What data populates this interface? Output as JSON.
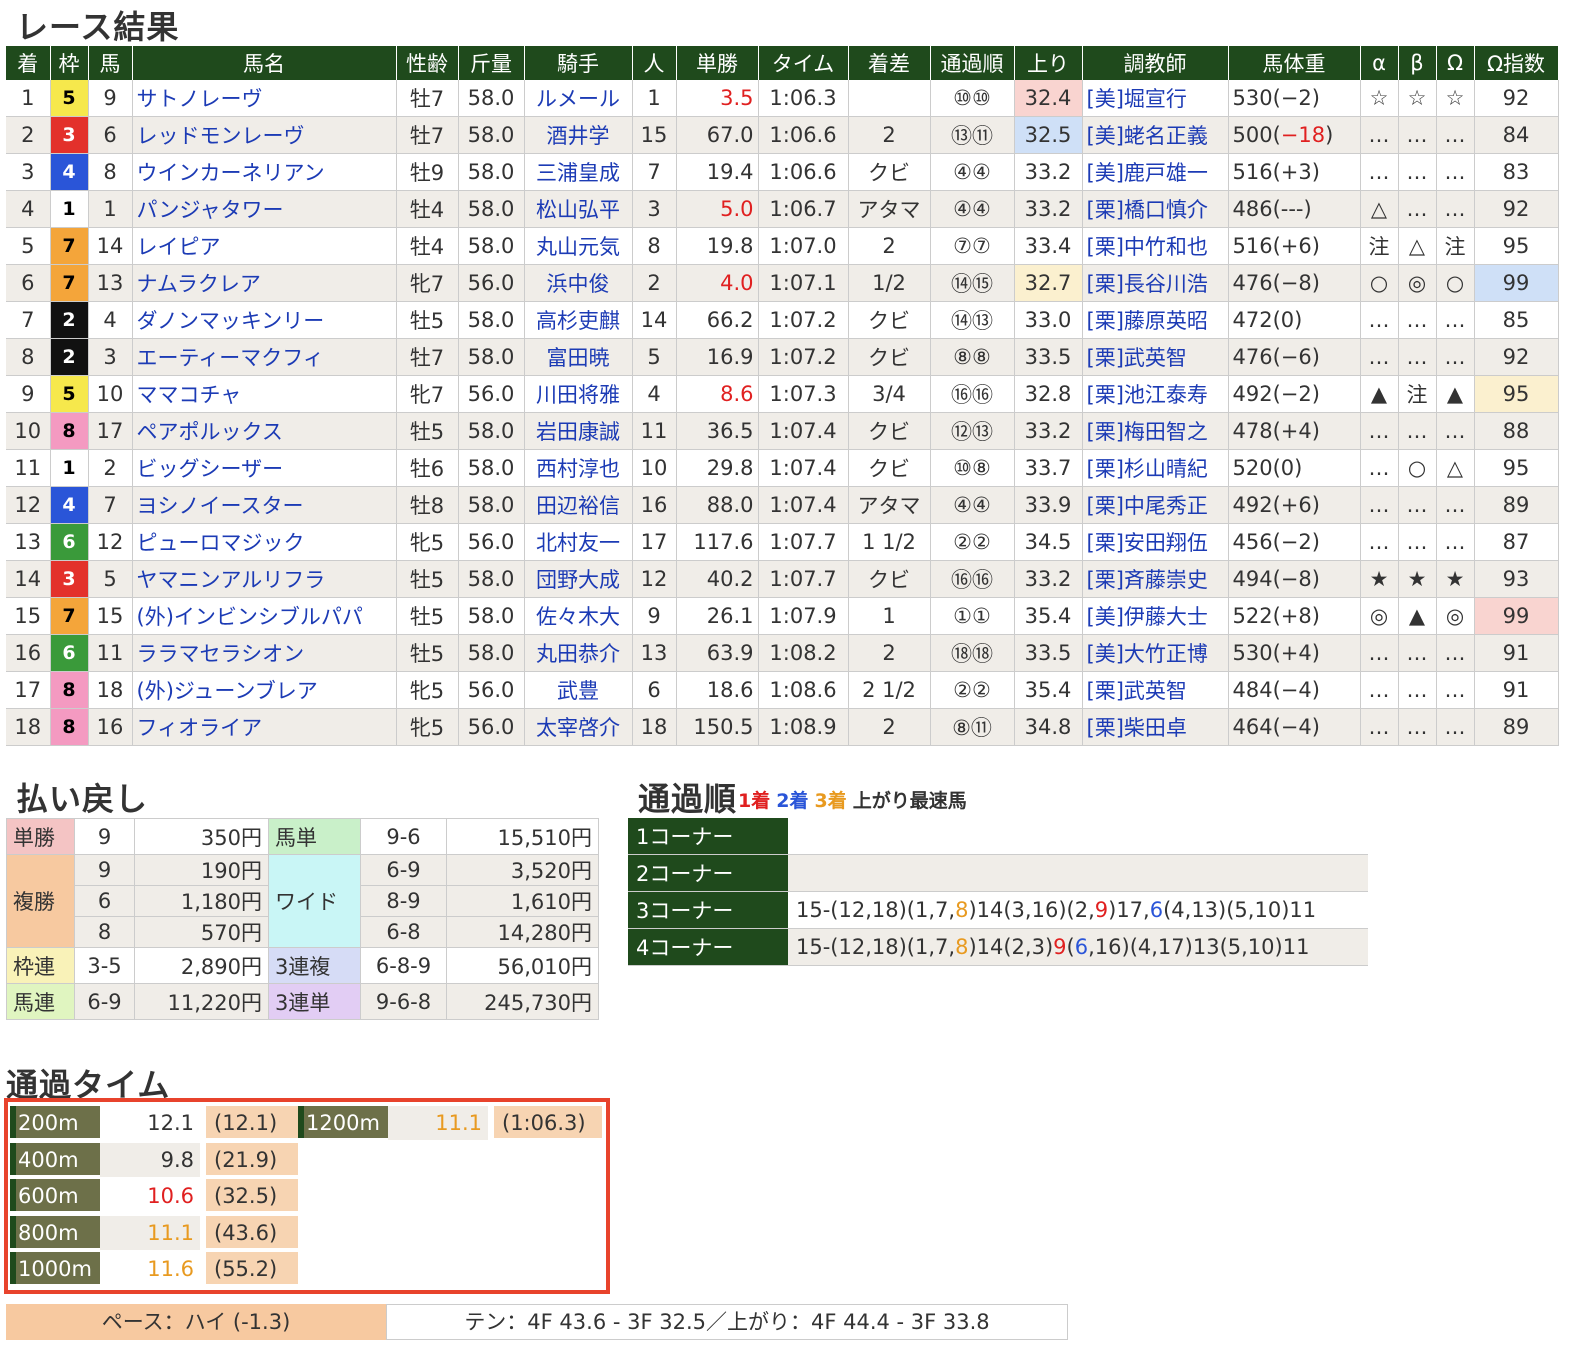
{
  "titles": {
    "results": "レース結果",
    "payout": "払い戻し",
    "passing": "通過順",
    "lap": "通過タイム"
  },
  "passing_legend": {
    "first": "1着",
    "second": "2着",
    "third": "3着",
    "fast": "上がり最速馬"
  },
  "colors": {
    "header": "#1f4a1c",
    "red": "#e02020",
    "blue": "#2a55d8",
    "orange": "#e89a20",
    "frame_highlight": "#e8432c"
  },
  "waku_colors": {
    "1": {
      "bg": "#ffffff",
      "fg": "#000000"
    },
    "2": {
      "bg": "#111111",
      "fg": "#ffffff"
    },
    "3": {
      "bg": "#e3312b",
      "fg": "#ffffff"
    },
    "4": {
      "bg": "#2a55d8",
      "fg": "#ffffff"
    },
    "5": {
      "bg": "#f6e84c",
      "fg": "#000000"
    },
    "6": {
      "bg": "#3a9a3a",
      "fg": "#ffffff"
    },
    "7": {
      "bg": "#f4a53a",
      "fg": "#000000"
    },
    "8": {
      "bg": "#f49ac1",
      "fg": "#000000"
    }
  },
  "results": {
    "headers": [
      "着",
      "枠",
      "馬",
      "馬名",
      "性齢",
      "斤量",
      "騎手",
      "人",
      "単勝",
      "タイム",
      "着差",
      "通過順",
      "上り",
      "調教師",
      "馬体重",
      "α",
      "β",
      "Ω",
      "Ω指数"
    ],
    "rows": [
      {
        "pos": "1",
        "waku": "5",
        "num": "9",
        "name": "サトノレーヴ",
        "sexage": "牡7",
        "weight": "58.0",
        "jockey": "ルメール",
        "pop": "1",
        "odds": "3.5",
        "odds_hl": "red",
        "time": "1:06.3",
        "margin": "",
        "pass": "⑩⑩",
        "last": "32.4",
        "last_hl": "#f9d4d0",
        "trainer": "[美]堀宣行",
        "bw": "530(−2)",
        "bw_neg": "",
        "a": "☆",
        "b": "☆",
        "o": "☆",
        "idx": "92",
        "idx_hl": ""
      },
      {
        "pos": "2",
        "waku": "3",
        "num": "6",
        "name": "レッドモンレーヴ",
        "sexage": "牡7",
        "weight": "58.0",
        "jockey": "酒井学",
        "pop": "15",
        "odds": "67.0",
        "odds_hl": "",
        "time": "1:06.6",
        "margin": "2",
        "pass": "⑬⑪",
        "last": "32.5",
        "last_hl": "#cfe0f7",
        "trainer": "[美]蛯名正義",
        "bw": "500(",
        "bw_neg": "−18",
        "a": "…",
        "b": "…",
        "o": "…",
        "idx": "84",
        "idx_hl": ""
      },
      {
        "pos": "3",
        "waku": "4",
        "num": "8",
        "name": "ウインカーネリアン",
        "sexage": "牡9",
        "weight": "58.0",
        "jockey": "三浦皇成",
        "pop": "7",
        "odds": "19.4",
        "odds_hl": "",
        "time": "1:06.6",
        "margin": "クビ",
        "pass": "④④",
        "last": "33.2",
        "last_hl": "",
        "trainer": "[美]鹿戸雄一",
        "bw": "516(+3)",
        "bw_neg": "",
        "a": "…",
        "b": "…",
        "o": "…",
        "idx": "83",
        "idx_hl": ""
      },
      {
        "pos": "4",
        "waku": "1",
        "num": "1",
        "name": "パンジャタワー",
        "sexage": "牡4",
        "weight": "58.0",
        "jockey": "松山弘平",
        "pop": "3",
        "odds": "5.0",
        "odds_hl": "red",
        "time": "1:06.7",
        "margin": "アタマ",
        "pass": "④④",
        "last": "33.2",
        "last_hl": "",
        "trainer": "[栗]橋口慎介",
        "bw": "486(---)",
        "bw_neg": "",
        "a": "△",
        "b": "…",
        "o": "…",
        "idx": "92",
        "idx_hl": ""
      },
      {
        "pos": "5",
        "waku": "7",
        "num": "14",
        "name": "レイピア",
        "sexage": "牡4",
        "weight": "58.0",
        "jockey": "丸山元気",
        "pop": "8",
        "odds": "19.8",
        "odds_hl": "",
        "time": "1:07.0",
        "margin": "2",
        "pass": "⑦⑦",
        "last": "33.4",
        "last_hl": "",
        "trainer": "[栗]中竹和也",
        "bw": "516(+6)",
        "bw_neg": "",
        "a": "注",
        "b": "△",
        "o": "注",
        "idx": "95",
        "idx_hl": ""
      },
      {
        "pos": "6",
        "waku": "7",
        "num": "13",
        "name": "ナムラクレア",
        "sexage": "牝7",
        "weight": "56.0",
        "jockey": "浜中俊",
        "pop": "2",
        "odds": "4.0",
        "odds_hl": "red",
        "time": "1:07.1",
        "margin": "1/2",
        "pass": "⑭⑮",
        "last": "32.7",
        "last_hl": "#fbf0cf",
        "trainer": "[栗]長谷川浩",
        "bw": "476(−8)",
        "bw_neg": "",
        "a": "○",
        "b": "◎",
        "o": "○",
        "idx": "99",
        "idx_hl": "#cfe0f7"
      },
      {
        "pos": "7",
        "waku": "2",
        "num": "4",
        "name": "ダノンマッキンリー",
        "sexage": "牡5",
        "weight": "58.0",
        "jockey": "高杉吏麒",
        "pop": "14",
        "odds": "66.2",
        "odds_hl": "",
        "time": "1:07.2",
        "margin": "クビ",
        "pass": "⑭⑬",
        "last": "33.0",
        "last_hl": "",
        "trainer": "[栗]藤原英昭",
        "bw": "472(0)",
        "bw_neg": "",
        "a": "…",
        "b": "…",
        "o": "…",
        "idx": "85",
        "idx_hl": ""
      },
      {
        "pos": "8",
        "waku": "2",
        "num": "3",
        "name": "エーティーマクフィ",
        "sexage": "牡7",
        "weight": "58.0",
        "jockey": "富田暁",
        "pop": "5",
        "odds": "16.9",
        "odds_hl": "",
        "time": "1:07.2",
        "margin": "クビ",
        "pass": "⑧⑧",
        "last": "33.5",
        "last_hl": "",
        "trainer": "[栗]武英智",
        "bw": "476(−6)",
        "bw_neg": "",
        "a": "…",
        "b": "…",
        "o": "…",
        "idx": "92",
        "idx_hl": ""
      },
      {
        "pos": "9",
        "waku": "5",
        "num": "10",
        "name": "ママコチャ",
        "sexage": "牝7",
        "weight": "56.0",
        "jockey": "川田将雅",
        "pop": "4",
        "odds": "8.6",
        "odds_hl": "red",
        "time": "1:07.3",
        "margin": "3/4",
        "pass": "⑯⑯",
        "last": "32.8",
        "last_hl": "",
        "trainer": "[栗]池江泰寿",
        "bw": "492(−2)",
        "bw_neg": "",
        "a": "▲",
        "b": "注",
        "o": "▲",
        "idx": "95",
        "idx_hl": "#fbf0cf"
      },
      {
        "pos": "10",
        "waku": "8",
        "num": "17",
        "name": "ペアポルックス",
        "sexage": "牡5",
        "weight": "58.0",
        "jockey": "岩田康誠",
        "pop": "11",
        "odds": "36.5",
        "odds_hl": "",
        "time": "1:07.4",
        "margin": "クビ",
        "pass": "⑫⑬",
        "last": "33.2",
        "last_hl": "",
        "trainer": "[栗]梅田智之",
        "bw": "478(+4)",
        "bw_neg": "",
        "a": "…",
        "b": "…",
        "o": "…",
        "idx": "88",
        "idx_hl": ""
      },
      {
        "pos": "11",
        "waku": "1",
        "num": "2",
        "name": "ビッグシーザー",
        "sexage": "牡6",
        "weight": "58.0",
        "jockey": "西村淳也",
        "pop": "10",
        "odds": "29.8",
        "odds_hl": "",
        "time": "1:07.4",
        "margin": "クビ",
        "pass": "⑩⑧",
        "last": "33.7",
        "last_hl": "",
        "trainer": "[栗]杉山晴紀",
        "bw": "520(0)",
        "bw_neg": "",
        "a": "…",
        "b": "○",
        "o": "△",
        "idx": "95",
        "idx_hl": ""
      },
      {
        "pos": "12",
        "waku": "4",
        "num": "7",
        "name": "ヨシノイースター",
        "sexage": "牡8",
        "weight": "58.0",
        "jockey": "田辺裕信",
        "pop": "16",
        "odds": "88.0",
        "odds_hl": "",
        "time": "1:07.4",
        "margin": "アタマ",
        "pass": "④④",
        "last": "33.9",
        "last_hl": "",
        "trainer": "[栗]中尾秀正",
        "bw": "492(+6)",
        "bw_neg": "",
        "a": "…",
        "b": "…",
        "o": "…",
        "idx": "89",
        "idx_hl": ""
      },
      {
        "pos": "13",
        "waku": "6",
        "num": "12",
        "name": "ピューロマジック",
        "sexage": "牝5",
        "weight": "56.0",
        "jockey": "北村友一",
        "pop": "17",
        "odds": "117.6",
        "odds_hl": "",
        "time": "1:07.7",
        "margin": "1 1/2",
        "pass": "②②",
        "last": "34.5",
        "last_hl": "",
        "trainer": "[栗]安田翔伍",
        "bw": "456(−2)",
        "bw_neg": "",
        "a": "…",
        "b": "…",
        "o": "…",
        "idx": "87",
        "idx_hl": ""
      },
      {
        "pos": "14",
        "waku": "3",
        "num": "5",
        "name": "ヤマニンアルリフラ",
        "sexage": "牡5",
        "weight": "58.0",
        "jockey": "団野大成",
        "pop": "12",
        "odds": "40.2",
        "odds_hl": "",
        "time": "1:07.7",
        "margin": "クビ",
        "pass": "⑯⑯",
        "last": "33.2",
        "last_hl": "",
        "trainer": "[栗]斉藤崇史",
        "bw": "494(−8)",
        "bw_neg": "",
        "a": "★",
        "b": "★",
        "o": "★",
        "idx": "93",
        "idx_hl": ""
      },
      {
        "pos": "15",
        "waku": "7",
        "num": "15",
        "name": "(外)インビンシブルパパ",
        "sexage": "牡5",
        "weight": "58.0",
        "jockey": "佐々木大",
        "pop": "9",
        "odds": "26.1",
        "odds_hl": "",
        "time": "1:07.9",
        "margin": "1",
        "pass": "①①",
        "last": "35.4",
        "last_hl": "",
        "trainer": "[美]伊藤大士",
        "bw": "522(+8)",
        "bw_neg": "",
        "a": "◎",
        "b": "▲",
        "o": "◎",
        "idx": "99",
        "idx_hl": "#f9d4d0"
      },
      {
        "pos": "16",
        "waku": "6",
        "num": "11",
        "name": "ララマセラシオン",
        "sexage": "牡5",
        "weight": "58.0",
        "jockey": "丸田恭介",
        "pop": "13",
        "odds": "63.9",
        "odds_hl": "",
        "time": "1:08.2",
        "margin": "2",
        "pass": "⑱⑱",
        "last": "33.5",
        "last_hl": "",
        "trainer": "[美]大竹正博",
        "bw": "530(+4)",
        "bw_neg": "",
        "a": "…",
        "b": "…",
        "o": "…",
        "idx": "91",
        "idx_hl": ""
      },
      {
        "pos": "17",
        "waku": "8",
        "num": "18",
        "name": "(外)ジューンブレア",
        "sexage": "牝5",
        "weight": "56.0",
        "jockey": "武豊",
        "pop": "6",
        "odds": "18.6",
        "odds_hl": "",
        "time": "1:08.6",
        "margin": "2 1/2",
        "pass": "②②",
        "last": "35.4",
        "last_hl": "",
        "trainer": "[栗]武英智",
        "bw": "484(−4)",
        "bw_neg": "",
        "a": "…",
        "b": "…",
        "o": "…",
        "idx": "91",
        "idx_hl": ""
      },
      {
        "pos": "18",
        "waku": "8",
        "num": "16",
        "name": "フィオライア",
        "sexage": "牝5",
        "weight": "56.0",
        "jockey": "太宰啓介",
        "pop": "18",
        "odds": "150.5",
        "odds_hl": "",
        "time": "1:08.9",
        "margin": "2",
        "pass": "⑧⑪",
        "last": "34.8",
        "last_hl": "",
        "trainer": "[栗]柴田卓",
        "bw": "464(−4)",
        "bw_neg": "",
        "a": "…",
        "b": "…",
        "o": "…",
        "idx": "89",
        "idx_hl": ""
      }
    ]
  },
  "payout": {
    "win": {
      "label": "単勝",
      "nums": [
        "9"
      ],
      "amounts": [
        "350円"
      ],
      "color": "#f4c4c4"
    },
    "exacta": {
      "label": "馬単",
      "nums": [
        "9-6"
      ],
      "amounts": [
        "15,510円"
      ],
      "color": "#c9f0c9"
    },
    "place": {
      "label": "複勝",
      "nums": [
        "9",
        "6",
        "8"
      ],
      "amounts": [
        "190円",
        "1,180円",
        "570円"
      ],
      "color": "#f7c9a0"
    },
    "wide": {
      "label": "ワイド",
      "nums": [
        "6-9",
        "8-9",
        "6-8"
      ],
      "amounts": [
        "3,520円",
        "1,610円",
        "14,280円"
      ],
      "color": "#c9f6f6"
    },
    "bracket": {
      "label": "枠連",
      "nums": [
        "3-5"
      ],
      "amounts": [
        "2,890円"
      ],
      "color": "#f9f2b8"
    },
    "trio": {
      "label": "3連複",
      "nums": [
        "6-8-9"
      ],
      "amounts": [
        "56,010円"
      ],
      "color": "#d6dcf6"
    },
    "quinella": {
      "label": "馬連",
      "nums": [
        "6-9"
      ],
      "amounts": [
        "11,220円"
      ],
      "color": "#e0f5c0"
    },
    "trifecta": {
      "label": "3連単",
      "nums": [
        "9-6-8"
      ],
      "amounts": [
        "245,730円"
      ],
      "color": "#e2cdf4"
    }
  },
  "passing_order": [
    {
      "label": "1コーナー",
      "segments": []
    },
    {
      "label": "2コーナー",
      "segments": []
    },
    {
      "label": "3コーナー",
      "segments": [
        {
          "t": "15-(12,18)(1,7,",
          "c": ""
        },
        {
          "t": "8",
          "c": "orange"
        },
        {
          "t": ")14(3,16)(2,",
          "c": ""
        },
        {
          "t": "9",
          "c": "red"
        },
        {
          "t": ")17,",
          "c": ""
        },
        {
          "t": "6",
          "c": "blue"
        },
        {
          "t": "(4,13)(5,10)11",
          "c": ""
        }
      ]
    },
    {
      "label": "4コーナー",
      "segments": [
        {
          "t": "15-(12,18)(1,7,",
          "c": ""
        },
        {
          "t": "8",
          "c": "orange"
        },
        {
          "t": ")14(2,3)",
          "c": ""
        },
        {
          "t": "9",
          "c": "red"
        },
        {
          "t": "(",
          "c": ""
        },
        {
          "t": "6",
          "c": "blue"
        },
        {
          "t": ",16)(4,17)13(5,10)11",
          "c": ""
        }
      ]
    }
  ],
  "lap_times": [
    {
      "dist": "200m",
      "split": "12.1",
      "split_color": "",
      "cum": "(12.1)"
    },
    {
      "dist": "400m",
      "split": "9.8",
      "split_color": "",
      "cum": "(21.9)"
    },
    {
      "dist": "600m",
      "split": "10.6",
      "split_color": "red",
      "cum": "(32.5)"
    },
    {
      "dist": "800m",
      "split": "11.1",
      "split_color": "orange",
      "cum": "(43.6)"
    },
    {
      "dist": "1000m",
      "split": "11.6",
      "split_color": "orange",
      "cum": "(55.2)"
    },
    {
      "dist": "1200m",
      "split": "11.1",
      "split_color": "orange",
      "cum": "(1:06.3)"
    }
  ],
  "pace": {
    "label": "ペース：ハイ (-1.3)",
    "detail": "テン：4F 43.6 - 3F 32.5／上がり：4F 44.4 - 3F 33.8"
  }
}
